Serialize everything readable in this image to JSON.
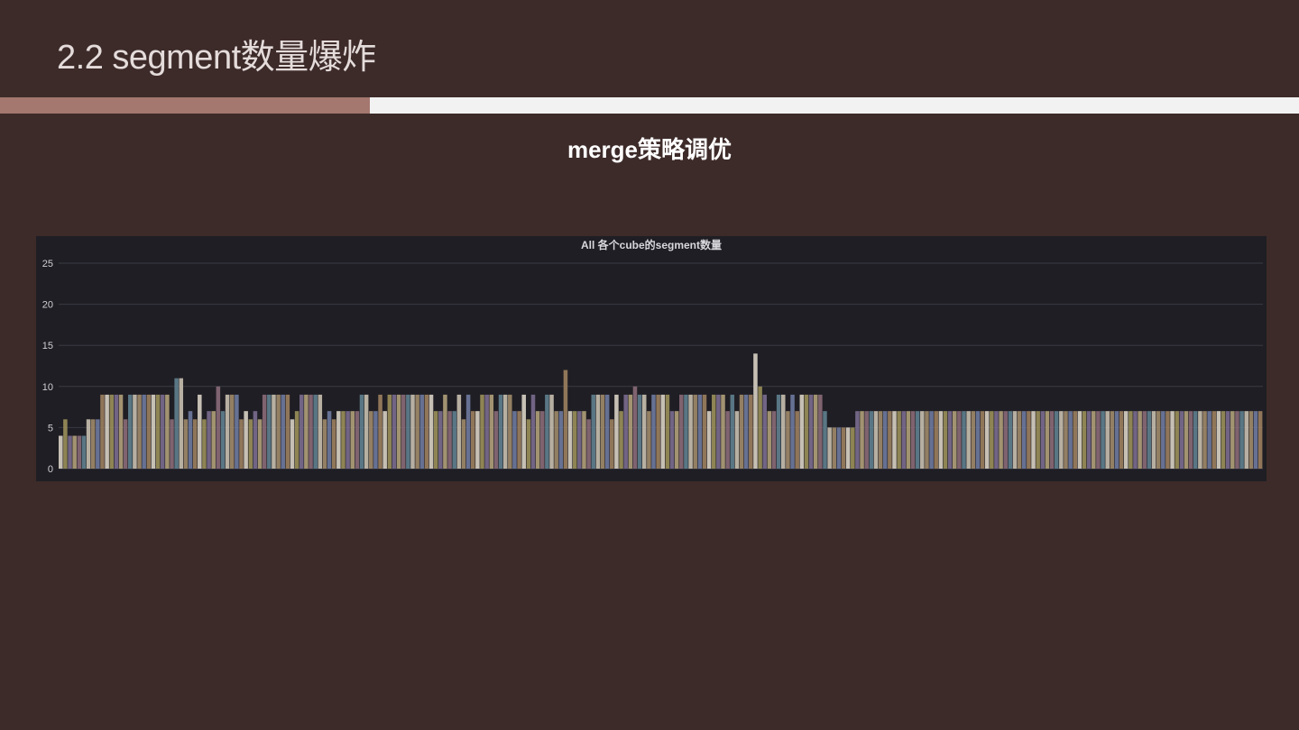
{
  "slide": {
    "title": "2.2 segment数量爆炸",
    "subtitle": "merge策略调优",
    "accent_color": "#a4776f",
    "background": "#3d2b29"
  },
  "chart_data": {
    "type": "bar",
    "title": "All 各个cube的segment数量",
    "ylim": [
      0,
      25
    ],
    "yticks": [
      0,
      5,
      10,
      15,
      20,
      25
    ],
    "grid": true,
    "legend": "none",
    "palette": [
      "#d8d0c4",
      "#9a8f5a",
      "#7a6b8f",
      "#b0a07a",
      "#8a6a78",
      "#5f7f8f",
      "#c8c0b0",
      "#a08a6a",
      "#6e7aa0",
      "#9c7f5f"
    ],
    "values": [
      4,
      6,
      4,
      4,
      4,
      4,
      6,
      6,
      6,
      9,
      9,
      9,
      9,
      9,
      6,
      9,
      9,
      9,
      9,
      9,
      9,
      9,
      9,
      9,
      6,
      11,
      11,
      6,
      7,
      6,
      9,
      6,
      7,
      7,
      10,
      7,
      9,
      9,
      9,
      6,
      7,
      6,
      7,
      6,
      9,
      9,
      9,
      9,
      9,
      9,
      6,
      7,
      9,
      9,
      9,
      9,
      9,
      6,
      7,
      6,
      7,
      7,
      7,
      7,
      7,
      9,
      9,
      7,
      7,
      9,
      7,
      9,
      9,
      9,
      9,
      9,
      9,
      9,
      9,
      9,
      9,
      7,
      7,
      9,
      7,
      7,
      9,
      6,
      9,
      7,
      7,
      9,
      9,
      9,
      7,
      9,
      9,
      9,
      7,
      7,
      9,
      6,
      9,
      7,
      7,
      9,
      9,
      7,
      7,
      12,
      7,
      7,
      7,
      7,
      6,
      9,
      9,
      9,
      9,
      6,
      9,
      7,
      9,
      9,
      10,
      9,
      9,
      7,
      9,
      9,
      9,
      9,
      7,
      7,
      9,
      9,
      9,
      9,
      9,
      9,
      7,
      9,
      9,
      9,
      7,
      9,
      7,
      9,
      9,
      9,
      14,
      10,
      9,
      7,
      7,
      9,
      9,
      7,
      9,
      7,
      9,
      9,
      9,
      9,
      9,
      7,
      5,
      5,
      5,
      5,
      5,
      5,
      7,
      7,
      7,
      7,
      7,
      7,
      7,
      7,
      7,
      7,
      7,
      7,
      7,
      7,
      7,
      7,
      7,
      7,
      7,
      7,
      7,
      7,
      7,
      7,
      7,
      7,
      7,
      7,
      7,
      7,
      7,
      7,
      7,
      7,
      7,
      7,
      7,
      7,
      7,
      7,
      7,
      7,
      7,
      7,
      7,
      7,
      7,
      7,
      7,
      7,
      7,
      7,
      7,
      7,
      7,
      7,
      7,
      7,
      7,
      7,
      7,
      7,
      7,
      7,
      7,
      7,
      7,
      7,
      7,
      7,
      7,
      7,
      7,
      7,
      7,
      7,
      7,
      7,
      7,
      7,
      7,
      7,
      7,
      7,
      7,
      7,
      7,
      7
    ]
  }
}
